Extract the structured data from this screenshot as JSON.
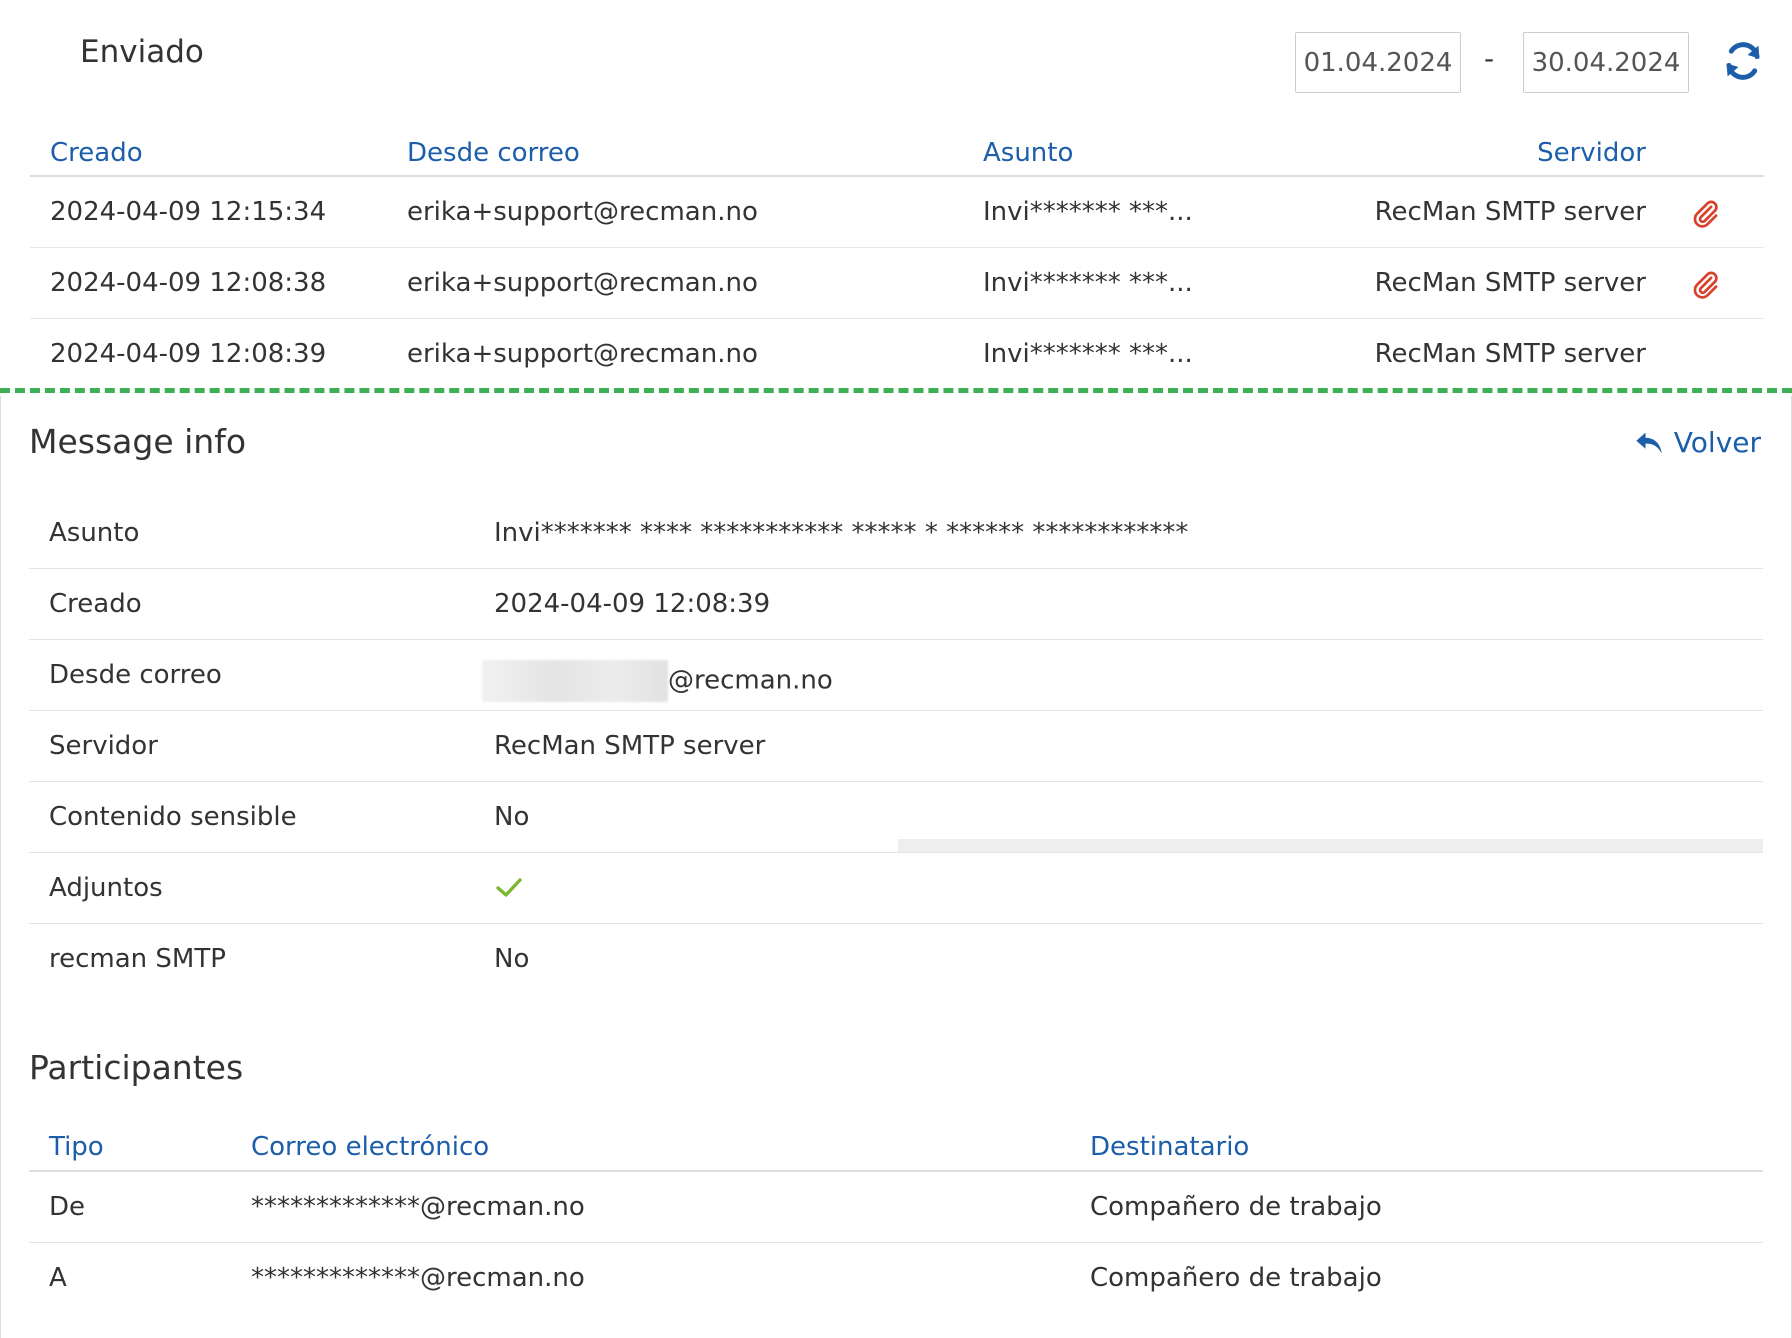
{
  "header": {
    "title": "Enviado",
    "date_from": "01.04.2024",
    "date_separator": "-",
    "date_to": "30.04.2024",
    "refresh_icon": "refresh-icon"
  },
  "sent_table": {
    "columns": {
      "created": "Creado",
      "from": "Desde correo",
      "subject": "Asunto",
      "server": "Servidor"
    },
    "rows": [
      {
        "created": "2024-04-09 12:15:34",
        "from": "erika+support@recman.no",
        "subject": "Invi******* ***...",
        "server": "RecMan SMTP server",
        "attachment": true
      },
      {
        "created": "2024-04-09 12:08:38",
        "from": "erika+support@recman.no",
        "subject": "Invi******* ***...",
        "server": "RecMan SMTP server",
        "attachment": true
      },
      {
        "created": "2024-04-09 12:08:39",
        "from": "erika+support@recman.no",
        "subject": "Invi******* ***...",
        "server": "RecMan SMTP server",
        "attachment": false
      }
    ]
  },
  "message_info": {
    "title": "Message info",
    "back_label": "Volver",
    "rows": {
      "subject": {
        "label": "Asunto",
        "value": "Invi******* **** *********** ***** * ****** ************"
      },
      "created": {
        "label": "Creado",
        "value": "2024-04-09 12:08:39"
      },
      "from": {
        "label": "Desde correo",
        "value": "@recman.no"
      },
      "server": {
        "label": "Servidor",
        "value": "RecMan SMTP server"
      },
      "sensitive": {
        "label": "Contenido sensible",
        "value": "No"
      },
      "attachments": {
        "label": "Adjuntos",
        "value_icon": "check-icon"
      },
      "recman_smtp": {
        "label": "recman SMTP",
        "value": "No"
      }
    }
  },
  "participants": {
    "title": "Participantes",
    "columns": {
      "type": "Tipo",
      "email": "Correo electrónico",
      "recipient": "Destinatario"
    },
    "rows": [
      {
        "type": "De",
        "email": "*************@recman.no",
        "recipient": "Compañero de trabajo"
      },
      {
        "type": "A",
        "email": "*************@recman.no",
        "recipient": "Compañero de trabajo"
      }
    ]
  },
  "colors": {
    "link_blue": "#1d5eab",
    "attachment_red": "#d9412b",
    "check_green": "#7cb82f",
    "dashed_green": "#3bb054"
  }
}
